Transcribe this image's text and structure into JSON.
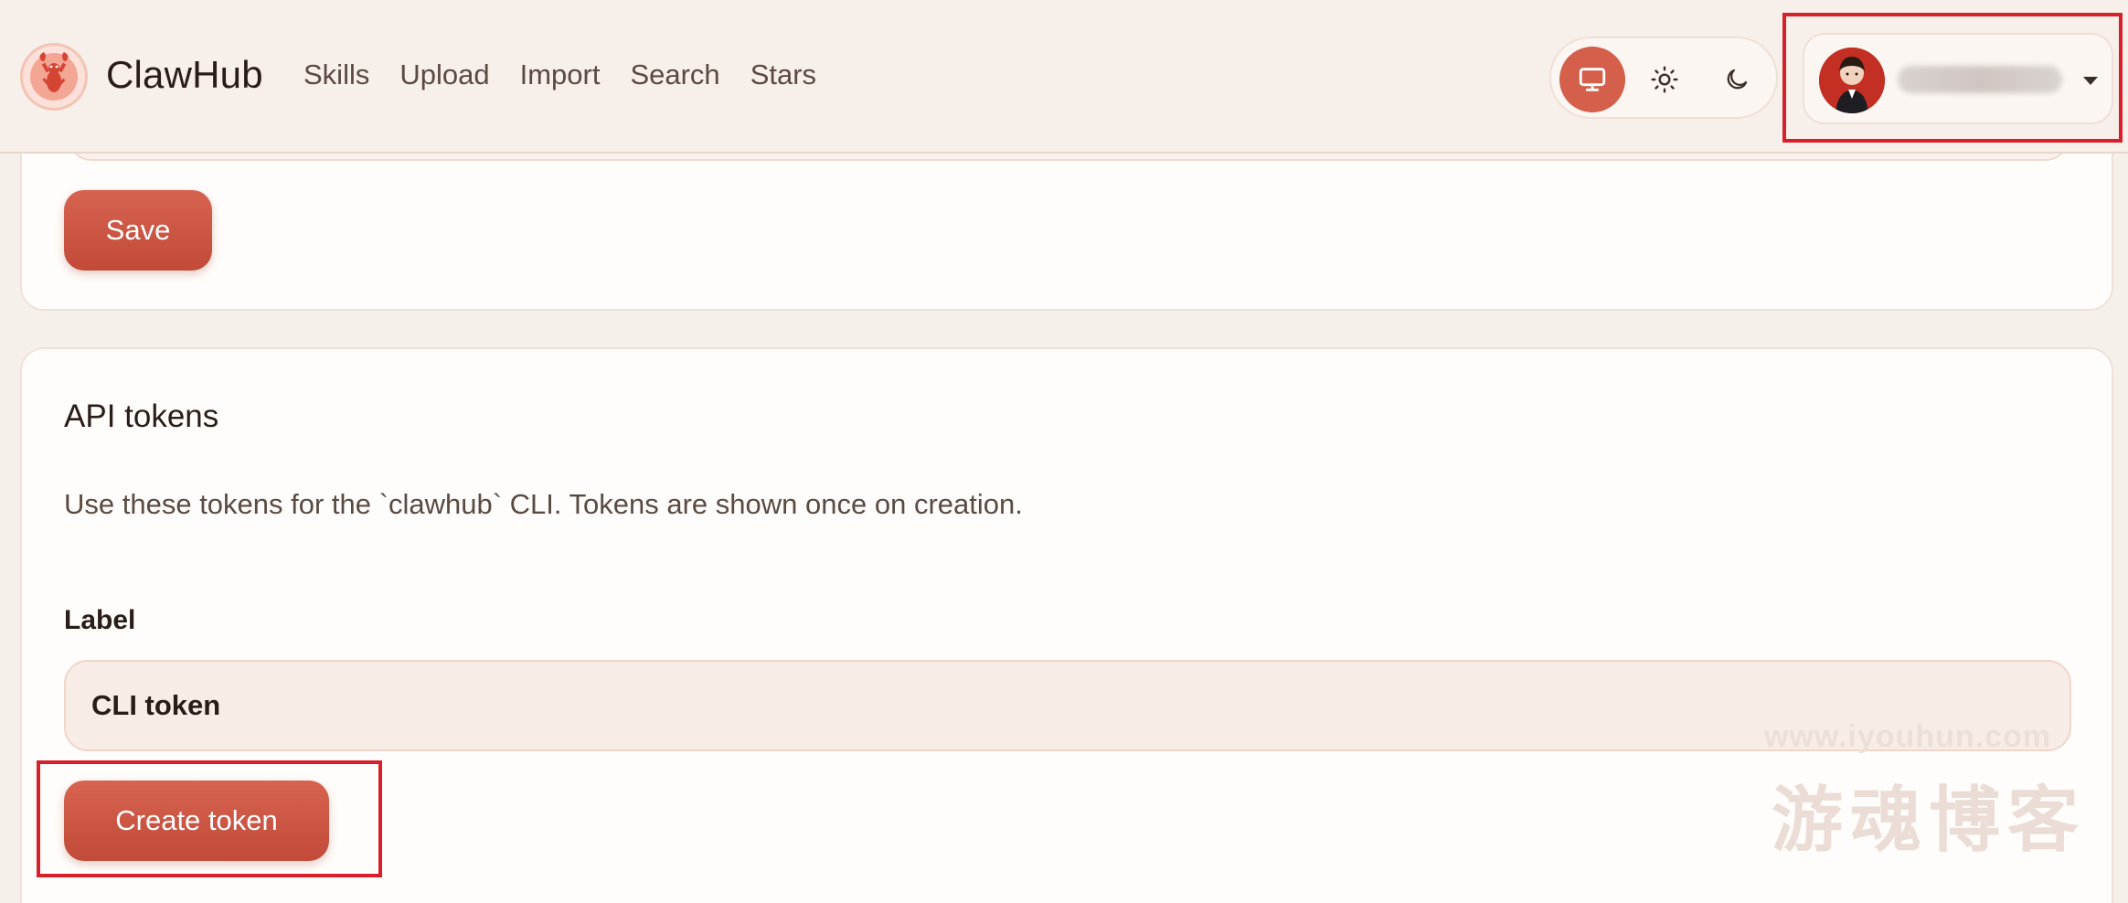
{
  "header": {
    "brand": "ClawHub",
    "nav": [
      "Skills",
      "Upload",
      "Import",
      "Search",
      "Stars"
    ],
    "theme_options": [
      {
        "icon": "monitor-icon",
        "active": true
      },
      {
        "icon": "sun-icon",
        "active": false
      },
      {
        "icon": "moon-icon",
        "active": false
      }
    ],
    "user": {
      "name": "",
      "avatar": "avatar-icon"
    }
  },
  "profile_card": {
    "save_label": "Save"
  },
  "api_tokens": {
    "title": "API tokens",
    "description": "Use these tokens for the `clawhub` CLI. Tokens are shown once on creation.",
    "label_field": "Label",
    "label_value": "CLI token",
    "create_label": "Create token"
  },
  "watermark": {
    "url": "www.iyouhun.com",
    "text": "游魂博客"
  },
  "colors": {
    "accent": "#d45f4a",
    "background": "#f6f0eb",
    "highlight": "#d6202b"
  }
}
